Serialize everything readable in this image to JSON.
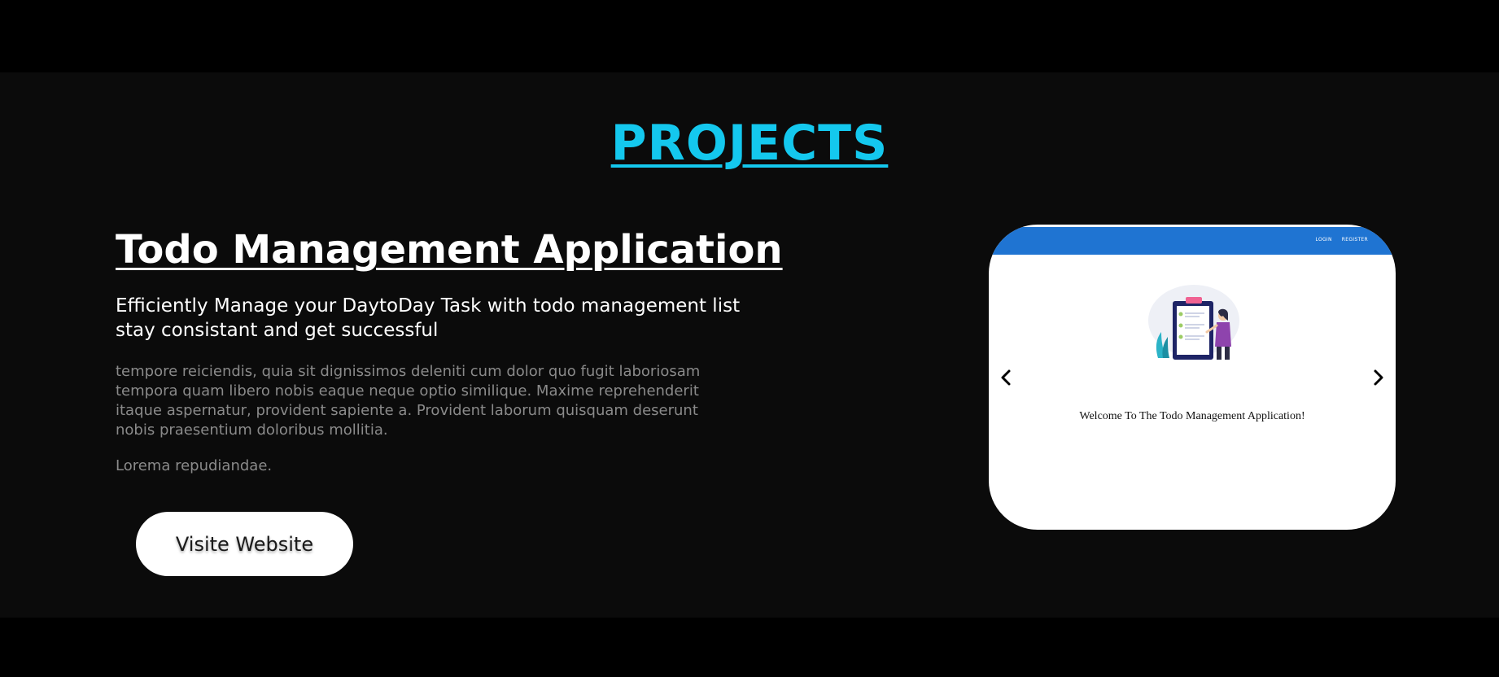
{
  "section": {
    "title": "PROJECTS"
  },
  "project": {
    "title": "Todo Management Application",
    "subtitle": "Efficiently Manage your DaytoDay Task with todo management list stay consistant and get successful",
    "description": "tempore reiciendis, quia sit dignissimos deleniti cum dolor quo fugit laboriosam tempora quam libero nobis eaque neque optio similique. Maxime reprehenderit itaque aspernatur, provident sapiente a. Provident laborum quisquam deserunt nobis praesentium doloribus mollitia.",
    "note": "Lorema repudiandae.",
    "visit_label": "Visite Website"
  },
  "carousel": {
    "prev_icon": "chevron-left-icon",
    "next_icon": "chevron-right-icon",
    "screenshot": {
      "nav_links": [
        "LOGIN",
        "REGISTER"
      ],
      "welcome_text": "Welcome To The Todo Management Application!"
    }
  },
  "colors": {
    "accent": "#14c8ee",
    "section_bg": "#0b0b0b",
    "screenshot_navbar": "#1f74d2"
  }
}
